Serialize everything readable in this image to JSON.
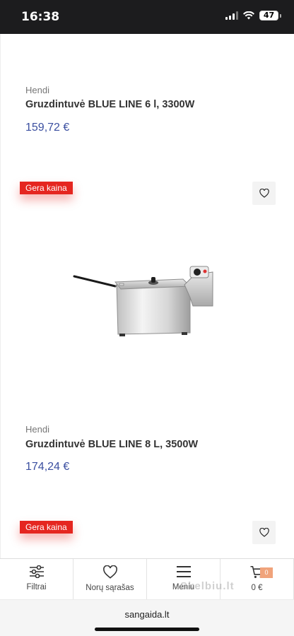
{
  "status_bar": {
    "time": "16:38",
    "battery": "47"
  },
  "products": [
    {
      "brand": "Hendi",
      "title": "Gruzdintuvė BLUE LINE 6 l, 3300W",
      "price": "159,72 €"
    },
    {
      "badge": "Gera kaina",
      "brand": "Hendi",
      "title": "Gruzdintuvė BLUE LINE 8 L, 3500W",
      "price": "174,24 €",
      "image_icon": "deep-fryer"
    },
    {
      "badge": "Gera kaina"
    }
  ],
  "icons": {
    "wishlist": "heart-icon",
    "filters": "sliders-icon",
    "menu": "hamburger-icon",
    "cart": "cart-icon"
  },
  "bottom_nav": {
    "filters": "Filtrai",
    "wishlist": "Norų sąrašas",
    "menu": "Meniu",
    "cart_total": "0 €",
    "cart_count": "0"
  },
  "watermark": "Skelbiu.lt",
  "browser": {
    "url": "sangaida.lt"
  },
  "colors": {
    "price": "#3b4fa0",
    "badge": "#e52620",
    "cart_badge": "#f0a37b"
  }
}
